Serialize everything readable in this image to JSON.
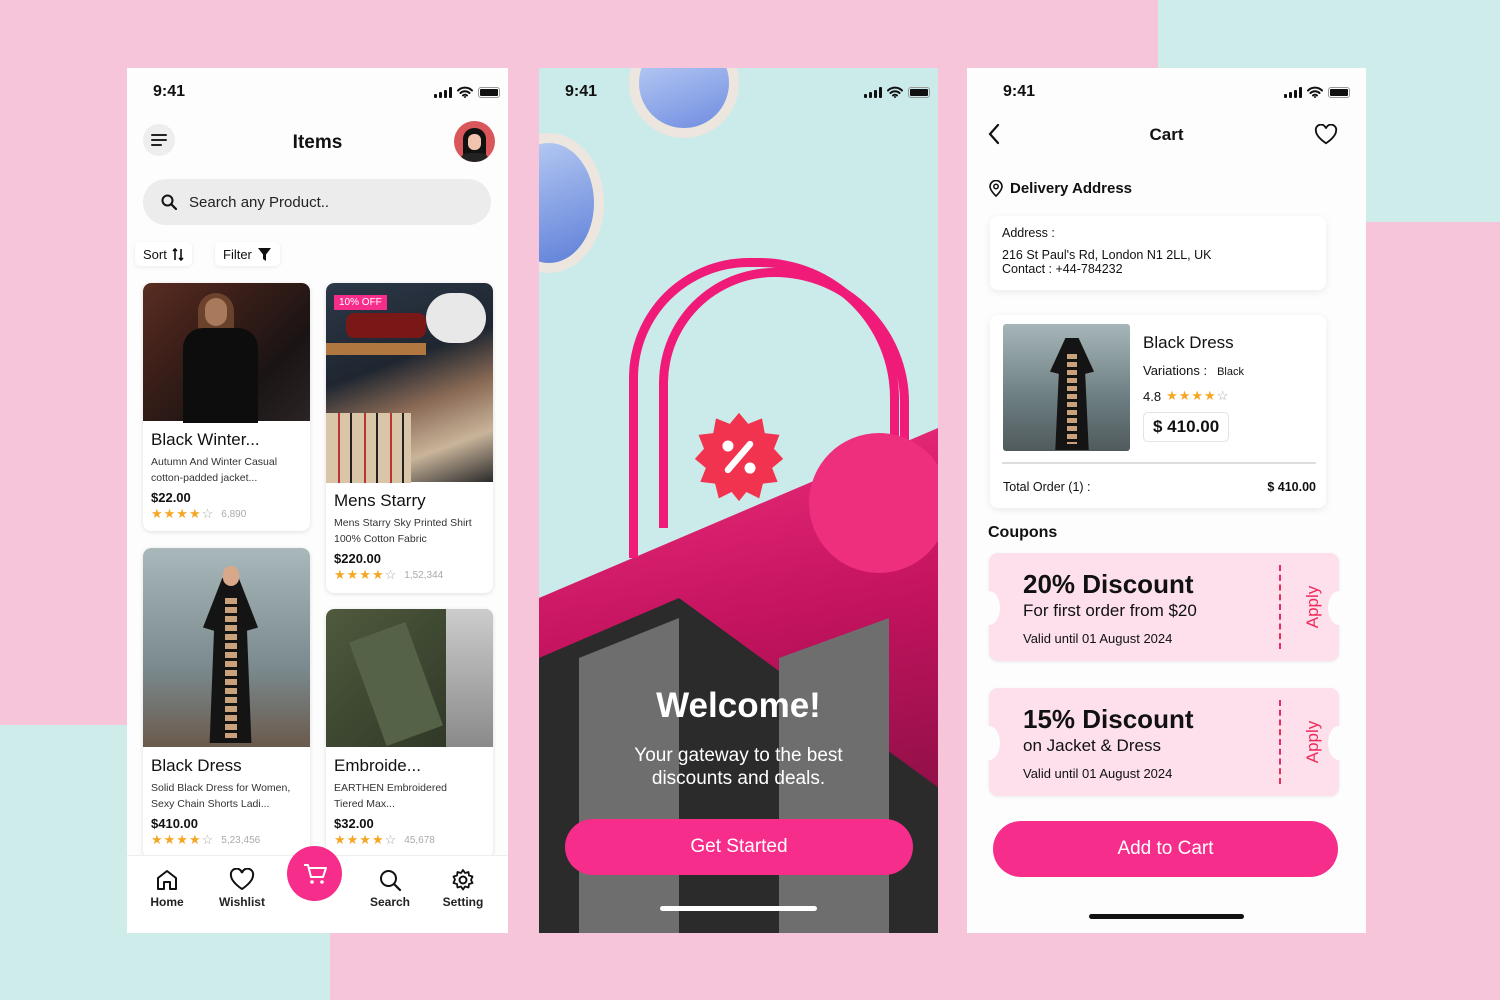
{
  "colors": {
    "accent": "#f72d8c",
    "bg_pink": "#f7c5d9",
    "bg_teal": "#cdecea",
    "coupon_bg": "#fde0ec",
    "coupon_accent": "#ee2a5a",
    "star": "#f5a623"
  },
  "status_bar": {
    "time": "9:41"
  },
  "items_screen": {
    "title": "Items",
    "menu_icon": "hamburger-menu-icon",
    "search": {
      "placeholder": "Search any Product.."
    },
    "sort_label": "Sort",
    "filter_label": "Filter",
    "products": [
      {
        "title": "Black Winter...",
        "desc1": "Autumn And Winter Casual",
        "desc2": "cotton-padded jacket...",
        "price": "$22.00",
        "stars_full": 4,
        "reviews": "6,890"
      },
      {
        "title": "Mens Starry",
        "badge": "10% OFF",
        "desc1": "Mens Starry Sky Printed Shirt",
        "desc2": "100% Cotton Fabric",
        "price": "$220.00",
        "stars_full": 4,
        "reviews": "1,52,344"
      },
      {
        "title": "Black Dress",
        "desc1": "Solid Black Dress for Women,",
        "desc2": "Sexy Chain Shorts Ladi...",
        "price": "$410.00",
        "stars_full": 4,
        "reviews": "5,23,456"
      },
      {
        "title": "Embroide...",
        "desc1": "EARTHEN Embroidered",
        "desc2": "Tiered Max...",
        "price": "$32.00",
        "stars_full": 4,
        "reviews": "45,678"
      }
    ],
    "nav": [
      {
        "label": "Home",
        "icon": "home-icon"
      },
      {
        "label": "Wishlist",
        "icon": "heart-icon"
      },
      {
        "label": "",
        "icon": "cart-icon"
      },
      {
        "label": "Search",
        "icon": "search-icon"
      },
      {
        "label": "Setting",
        "icon": "gear-icon"
      }
    ]
  },
  "welcome_screen": {
    "title": "Welcome!",
    "subtitle_line1": "Your gateway to the best",
    "subtitle_line2": "discounts and deals.",
    "cta": "Get Started"
  },
  "cart_screen": {
    "title": "Cart",
    "delivery_heading": "Delivery Address",
    "address_label": "Address :",
    "address": "216 St Paul's Rd, London N1 2LL, UK",
    "contact": "Contact :  +44-784232",
    "item": {
      "name": "Black Dress",
      "variations_label": "Variations :",
      "variation": "Black",
      "rating": "4.8",
      "stars_full": 4,
      "price": "$ 410.00"
    },
    "total_label": "Total Order (1)   :",
    "total_value": "$ 410.00",
    "coupons_heading": "Coupons",
    "coupons": [
      {
        "title": "20% Discount",
        "subtitle": "For first order from $20",
        "validity": "Valid until 01 August 2024",
        "action": "Apply"
      },
      {
        "title": "15% Discount",
        "subtitle": "on Jacket & Dress",
        "validity": "Valid until 01 August 2024",
        "action": "Apply"
      }
    ],
    "cta": "Add to Cart"
  }
}
